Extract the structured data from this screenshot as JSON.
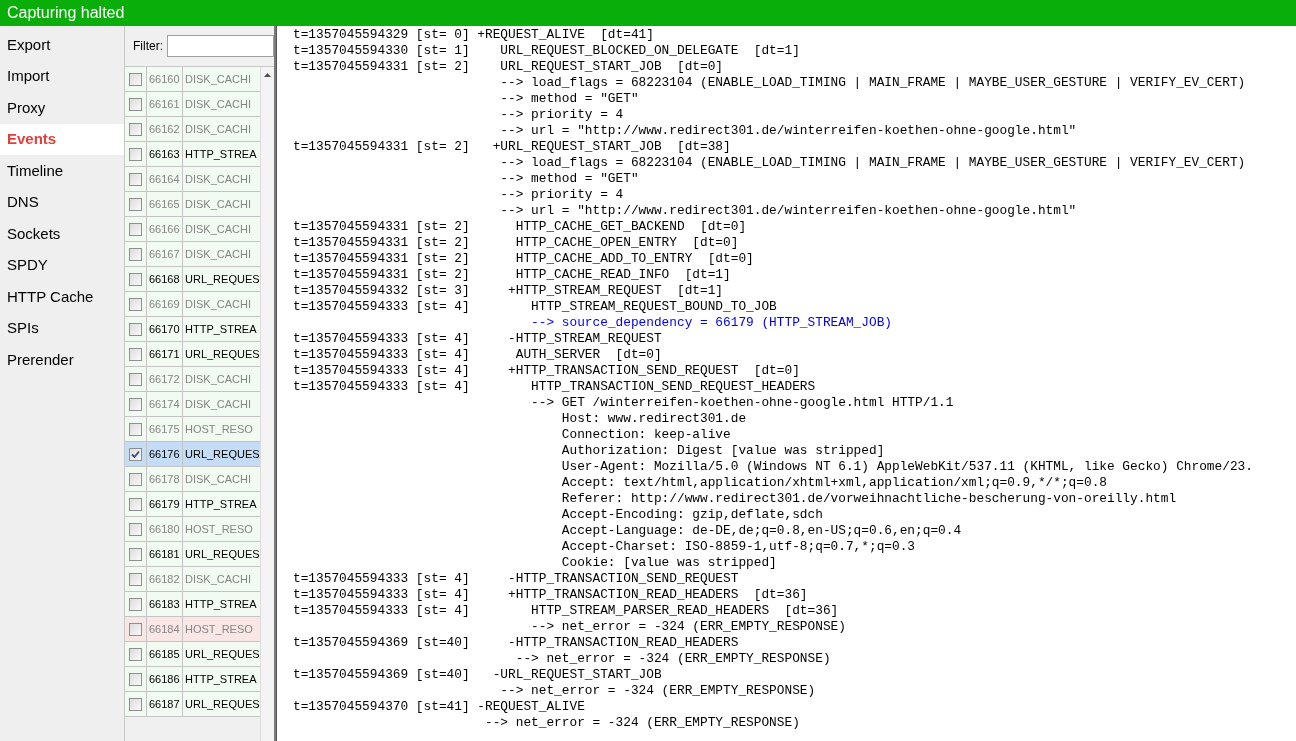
{
  "status_bar": {
    "title": "Capturing halted"
  },
  "sidebar": {
    "items": [
      {
        "label": "Export",
        "selected": false
      },
      {
        "label": "Import",
        "selected": false
      },
      {
        "label": "Proxy",
        "selected": false
      },
      {
        "label": "Events",
        "selected": true
      },
      {
        "label": "Timeline",
        "selected": false
      },
      {
        "label": "DNS",
        "selected": false
      },
      {
        "label": "Sockets",
        "selected": false
      },
      {
        "label": "SPDY",
        "selected": false
      },
      {
        "label": "HTTP Cache",
        "selected": false
      },
      {
        "label": "SPIs",
        "selected": false
      },
      {
        "label": "Prerender",
        "selected": false
      }
    ]
  },
  "events": {
    "filter_label": "Filter:",
    "rows": [
      {
        "id": "66160",
        "type": "DISK_CACHI",
        "active": false,
        "error": false,
        "checked": false,
        "selected": false
      },
      {
        "id": "66161",
        "type": "DISK_CACHI",
        "active": false,
        "error": false,
        "checked": false,
        "selected": false
      },
      {
        "id": "66162",
        "type": "DISK_CACHI",
        "active": false,
        "error": false,
        "checked": false,
        "selected": false
      },
      {
        "id": "66163",
        "type": "HTTP_STREA",
        "active": true,
        "error": false,
        "checked": false,
        "selected": false
      },
      {
        "id": "66164",
        "type": "DISK_CACHI",
        "active": false,
        "error": false,
        "checked": false,
        "selected": false
      },
      {
        "id": "66165",
        "type": "DISK_CACHI",
        "active": false,
        "error": false,
        "checked": false,
        "selected": false
      },
      {
        "id": "66166",
        "type": "DISK_CACHI",
        "active": false,
        "error": false,
        "checked": false,
        "selected": false
      },
      {
        "id": "66167",
        "type": "DISK_CACHI",
        "active": false,
        "error": false,
        "checked": false,
        "selected": false
      },
      {
        "id": "66168",
        "type": "URL_REQUES",
        "active": true,
        "error": false,
        "checked": false,
        "selected": false
      },
      {
        "id": "66169",
        "type": "DISK_CACHI",
        "active": false,
        "error": false,
        "checked": false,
        "selected": false
      },
      {
        "id": "66170",
        "type": "HTTP_STREA",
        "active": true,
        "error": false,
        "checked": false,
        "selected": false
      },
      {
        "id": "66171",
        "type": "URL_REQUES",
        "active": true,
        "error": false,
        "checked": false,
        "selected": false
      },
      {
        "id": "66172",
        "type": "DISK_CACHI",
        "active": false,
        "error": false,
        "checked": false,
        "selected": false
      },
      {
        "id": "66174",
        "type": "DISK_CACHI",
        "active": false,
        "error": false,
        "checked": false,
        "selected": false
      },
      {
        "id": "66175",
        "type": "HOST_RESO",
        "active": false,
        "error": false,
        "checked": false,
        "selected": false
      },
      {
        "id": "66176",
        "type": "URL_REQUES",
        "active": true,
        "error": false,
        "checked": true,
        "selected": true
      },
      {
        "id": "66178",
        "type": "DISK_CACHI",
        "active": false,
        "error": false,
        "checked": false,
        "selected": false
      },
      {
        "id": "66179",
        "type": "HTTP_STREA",
        "active": true,
        "error": false,
        "checked": false,
        "selected": false
      },
      {
        "id": "66180",
        "type": "HOST_RESO",
        "active": false,
        "error": false,
        "checked": false,
        "selected": false
      },
      {
        "id": "66181",
        "type": "URL_REQUES",
        "active": true,
        "error": false,
        "checked": false,
        "selected": false
      },
      {
        "id": "66182",
        "type": "DISK_CACHI",
        "active": false,
        "error": false,
        "checked": false,
        "selected": false
      },
      {
        "id": "66183",
        "type": "HTTP_STREA",
        "active": true,
        "error": false,
        "checked": false,
        "selected": false
      },
      {
        "id": "66184",
        "type": "HOST_RESO",
        "active": false,
        "error": true,
        "checked": false,
        "selected": false
      },
      {
        "id": "66185",
        "type": "URL_REQUES",
        "active": true,
        "error": false,
        "checked": false,
        "selected": false
      },
      {
        "id": "66186",
        "type": "HTTP_STREA",
        "active": true,
        "error": false,
        "checked": false,
        "selected": false
      },
      {
        "id": "66187",
        "type": "URL_REQUES",
        "active": true,
        "error": false,
        "checked": false,
        "selected": false
      }
    ]
  },
  "log": {
    "lines": [
      {
        "kind": "plain",
        "text": "t=1357045594329 [st= 0] +REQUEST_ALIVE  [dt=41]"
      },
      {
        "kind": "plain",
        "text": "t=1357045594330 [st= 1]    URL_REQUEST_BLOCKED_ON_DELEGATE  [dt=1]"
      },
      {
        "kind": "plain",
        "text": "t=1357045594331 [st= 2]    URL_REQUEST_START_JOB  [dt=0]"
      },
      {
        "kind": "plain",
        "text": "                           --> load_flags = 68223104 (ENABLE_LOAD_TIMING | MAIN_FRAME | MAYBE_USER_GESTURE | VERIFY_EV_CERT)"
      },
      {
        "kind": "plain",
        "text": "                           --> method = \"GET\""
      },
      {
        "kind": "plain",
        "text": "                           --> priority = 4"
      },
      {
        "kind": "plain",
        "text": "                           --> url = \"http://www.redirect301.de/winterreifen-koethen-ohne-google.html\""
      },
      {
        "kind": "plain",
        "text": "t=1357045594331 [st= 2]   +URL_REQUEST_START_JOB  [dt=38]"
      },
      {
        "kind": "plain",
        "text": "                           --> load_flags = 68223104 (ENABLE_LOAD_TIMING | MAIN_FRAME | MAYBE_USER_GESTURE | VERIFY_EV_CERT)"
      },
      {
        "kind": "plain",
        "text": "                           --> method = \"GET\""
      },
      {
        "kind": "plain",
        "text": "                           --> priority = 4"
      },
      {
        "kind": "plain",
        "text": "                           --> url = \"http://www.redirect301.de/winterreifen-koethen-ohne-google.html\""
      },
      {
        "kind": "plain",
        "text": "t=1357045594331 [st= 2]      HTTP_CACHE_GET_BACKEND  [dt=0]"
      },
      {
        "kind": "plain",
        "text": "t=1357045594331 [st= 2]      HTTP_CACHE_OPEN_ENTRY  [dt=0]"
      },
      {
        "kind": "plain",
        "text": "t=1357045594331 [st= 2]      HTTP_CACHE_ADD_TO_ENTRY  [dt=0]"
      },
      {
        "kind": "plain",
        "text": "t=1357045594331 [st= 2]      HTTP_CACHE_READ_INFO  [dt=1]"
      },
      {
        "kind": "plain",
        "text": "t=1357045594332 [st= 3]     +HTTP_STREAM_REQUEST  [dt=1]"
      },
      {
        "kind": "plain",
        "text": "t=1357045594333 [st= 4]        HTTP_STREAM_REQUEST_BOUND_TO_JOB"
      },
      {
        "kind": "link",
        "text": "                               --> source_dependency = 66179 (HTTP_STREAM_JOB)"
      },
      {
        "kind": "plain",
        "text": "t=1357045594333 [st= 4]     -HTTP_STREAM_REQUEST"
      },
      {
        "kind": "plain",
        "text": "t=1357045594333 [st= 4]      AUTH_SERVER  [dt=0]"
      },
      {
        "kind": "plain",
        "text": "t=1357045594333 [st= 4]     +HTTP_TRANSACTION_SEND_REQUEST  [dt=0]"
      },
      {
        "kind": "plain",
        "text": "t=1357045594333 [st= 4]        HTTP_TRANSACTION_SEND_REQUEST_HEADERS"
      },
      {
        "kind": "plain",
        "text": "                               --> GET /winterreifen-koethen-ohne-google.html HTTP/1.1"
      },
      {
        "kind": "plain",
        "text": "                                   Host: www.redirect301.de"
      },
      {
        "kind": "plain",
        "text": "                                   Connection: keep-alive"
      },
      {
        "kind": "plain",
        "text": "                                   Authorization: Digest [value was stripped]"
      },
      {
        "kind": "plain",
        "text": "                                   User-Agent: Mozilla/5.0 (Windows NT 6.1) AppleWebKit/537.11 (KHTML, like Gecko) Chrome/23."
      },
      {
        "kind": "plain",
        "text": "                                   Accept: text/html,application/xhtml+xml,application/xml;q=0.9,*/*;q=0.8"
      },
      {
        "kind": "plain",
        "text": "                                   Referer: http://www.redirect301.de/vorweihnachtliche-bescherung-von-oreilly.html"
      },
      {
        "kind": "plain",
        "text": "                                   Accept-Encoding: gzip,deflate,sdch"
      },
      {
        "kind": "plain",
        "text": "                                   Accept-Language: de-DE,de;q=0.8,en-US;q=0.6,en;q=0.4"
      },
      {
        "kind": "plain",
        "text": "                                   Accept-Charset: ISO-8859-1,utf-8;q=0.7,*;q=0.3"
      },
      {
        "kind": "plain",
        "text": "                                   Cookie: [value was stripped]"
      },
      {
        "kind": "plain",
        "text": "t=1357045594333 [st= 4]     -HTTP_TRANSACTION_SEND_REQUEST"
      },
      {
        "kind": "plain",
        "text": "t=1357045594333 [st= 4]     +HTTP_TRANSACTION_READ_HEADERS  [dt=36]"
      },
      {
        "kind": "plain",
        "text": "t=1357045594333 [st= 4]        HTTP_STREAM_PARSER_READ_HEADERS  [dt=36]"
      },
      {
        "kind": "plain",
        "text": "                               --> net_error = -324 (ERR_EMPTY_RESPONSE)"
      },
      {
        "kind": "plain",
        "text": "t=1357045594369 [st=40]     -HTTP_TRANSACTION_READ_HEADERS"
      },
      {
        "kind": "plain",
        "text": "                             --> net_error = -324 (ERR_EMPTY_RESPONSE)"
      },
      {
        "kind": "plain",
        "text": "t=1357045594369 [st=40]   -URL_REQUEST_START_JOB"
      },
      {
        "kind": "plain",
        "text": "                           --> net_error = -324 (ERR_EMPTY_RESPONSE)"
      },
      {
        "kind": "plain",
        "text": "t=1357045594370 [st=41] -REQUEST_ALIVE"
      },
      {
        "kind": "plain",
        "text": "                         --> net_error = -324 (ERR_EMPTY_RESPONSE)"
      }
    ]
  }
}
